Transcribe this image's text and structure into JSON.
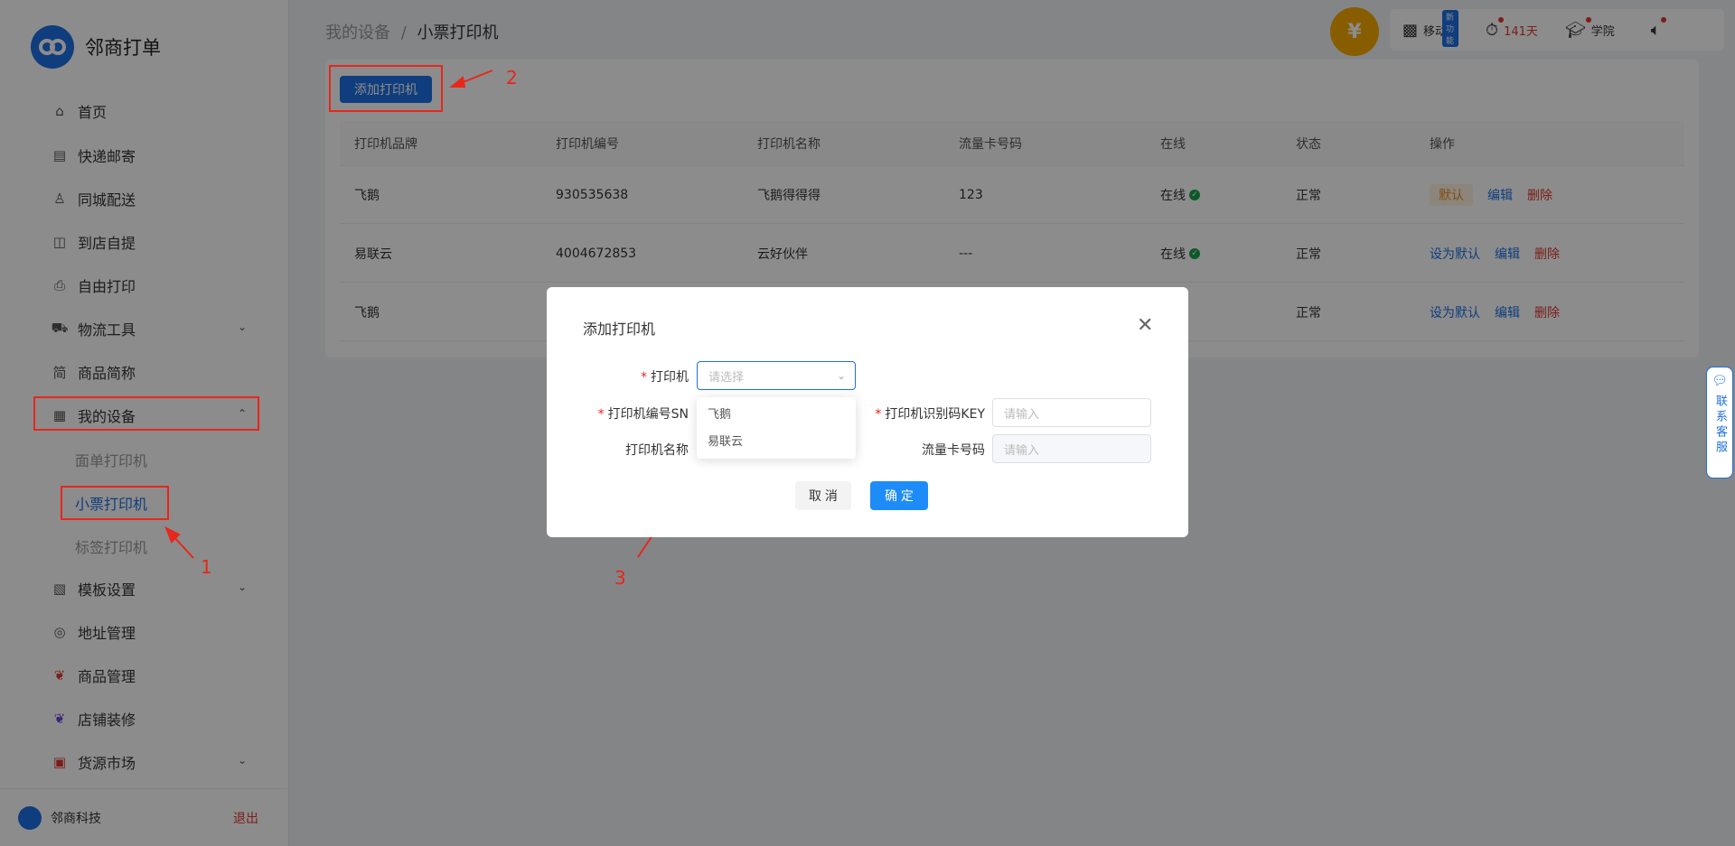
{
  "brand": {
    "name": "邻商打单"
  },
  "menu": [
    {
      "label": "首页",
      "icon": "home-icon"
    },
    {
      "label": "快递邮寄",
      "icon": "clipboard-icon"
    },
    {
      "label": "同城配送",
      "icon": "person-icon"
    },
    {
      "label": "到店自提",
      "icon": "bag-icon"
    },
    {
      "label": "自由打印",
      "icon": "printer-icon"
    },
    {
      "label": "物流工具",
      "icon": "truck-icon"
    },
    {
      "label": "商品简称",
      "icon": "text-icon"
    },
    {
      "label": "我的设备",
      "icon": "device-icon"
    },
    {
      "label": "模板设置",
      "icon": "template-icon"
    },
    {
      "label": "地址管理",
      "icon": "location-icon"
    },
    {
      "label": "商品管理",
      "icon": "goods-icon"
    },
    {
      "label": "店铺装修",
      "icon": "decor-icon"
    },
    {
      "label": "货源市场",
      "icon": "market-icon"
    }
  ],
  "submenu": [
    "面单打印机",
    "小票打印机",
    "标签打印机"
  ],
  "footer": {
    "name": "邻商科技",
    "logout": "退出"
  },
  "breadcrumb": {
    "parent": "我的设备",
    "sep": "/",
    "current": "小票打印机"
  },
  "topbar": {
    "mobile": "移动端",
    "new_badge": "新功能",
    "days": "141天",
    "academy": "学院"
  },
  "toolbar": {
    "add_label": "添加打印机"
  },
  "table": {
    "headers": [
      "打印机品牌",
      "打印机编号",
      "打印机名称",
      "流量卡号码",
      "在线",
      "状态",
      "操作"
    ],
    "rows": [
      {
        "brand": "飞鹅",
        "sn": "930535638",
        "name": "飞鹅得得得",
        "card": "123",
        "online": "在线",
        "status": "正常",
        "default_tag": "默认",
        "set_default": "",
        "edit": "编辑",
        "delete": "删除"
      },
      {
        "brand": "易联云",
        "sn": "4004672853",
        "name": "云好伙伴",
        "card": "---",
        "online": "在线",
        "status": "正常",
        "default_tag": "",
        "set_default": "设为默认",
        "edit": "编辑",
        "delete": "删除"
      },
      {
        "brand": "飞鹅",
        "sn": "",
        "name": "",
        "card": "",
        "online": "",
        "status": "正常",
        "default_tag": "",
        "set_default": "设为默认",
        "edit": "编辑",
        "delete": "删除"
      }
    ]
  },
  "dialog": {
    "title": "添加打印机",
    "printer_label": "打印机",
    "printer_placeholder": "请选择",
    "options": [
      "飞鹅",
      "易联云"
    ],
    "sn_label": "打印机编号SN",
    "key_label": "打印机识别码KEY",
    "key_placeholder": "请输入",
    "name_label": "打印机名称",
    "card_label": "流量卡号码",
    "card_placeholder": "请输入",
    "cancel": "取 消",
    "ok": "确 定"
  },
  "annotations": [
    "1",
    "2",
    "3"
  ],
  "chat": {
    "label": "联系客服"
  }
}
